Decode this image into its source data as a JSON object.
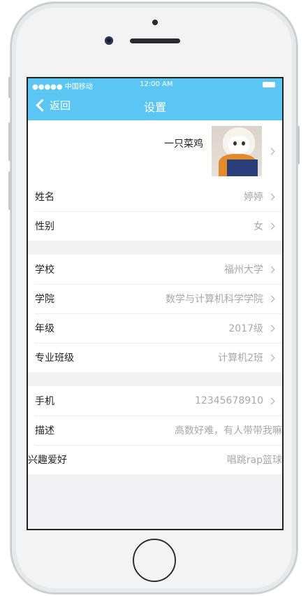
{
  "status": {
    "carrier": "●●●●● 中国移动",
    "time": "12:00 AM"
  },
  "nav": {
    "back_label": "返回",
    "title": "设置"
  },
  "profile": {
    "nickname": "一只菜鸡"
  },
  "groups": [
    {
      "rows": [
        {
          "label": "姓名",
          "value": "婷婷"
        },
        {
          "label": "性别",
          "value": "女"
        }
      ]
    },
    {
      "rows": [
        {
          "label": "学校",
          "value": "福州大学"
        },
        {
          "label": "学院",
          "value": "数学与计算机科学学院"
        },
        {
          "label": "年级",
          "value": "2017级"
        },
        {
          "label": "专业班级",
          "value": "计算机2班"
        }
      ]
    },
    {
      "rows": [
        {
          "label": "手机",
          "value": "12345678910"
        },
        {
          "label": "描述",
          "value": "高数好难，有人带带我嘛"
        },
        {
          "label": "兴趣爱好",
          "value": "唱跳rap篮球"
        }
      ]
    }
  ]
}
